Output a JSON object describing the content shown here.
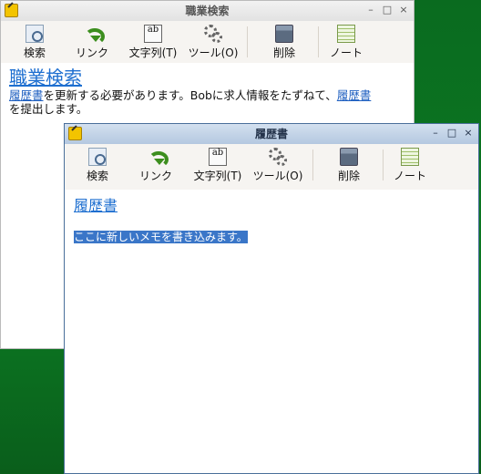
{
  "colors": {
    "link": "#1e5fc0",
    "desktop": "#0c7a23",
    "selection": "#3a76c8"
  },
  "toolbar": {
    "search": "検索",
    "link": "リンク",
    "text": "文字列(T)",
    "tools": "ツール(O)",
    "delete": "削除",
    "note": "ノート",
    "text_icon_glyph": "ab",
    "icons": [
      "magnifier-icon",
      "link-arrow-icon",
      "text-style-icon",
      "gears-icon",
      "trash-icon",
      "note-icon"
    ]
  },
  "back_window": {
    "title": "職業検索",
    "heading": "職業検索",
    "body_link1": "履歴書",
    "body_text1": "を更新する必要があります。Bobに求人情報をたずねて、",
    "body_link2": "履歴書",
    "body_text2": "を提出します。",
    "controls": {
      "minimize": "–",
      "maximize": "□",
      "close": "×"
    }
  },
  "front_window": {
    "title": "履歴書",
    "heading": "履歴書",
    "selected_text": "ここに新しいメモを書き込みます。",
    "controls": {
      "minimize": "–",
      "maximize": "□",
      "close": "×"
    }
  }
}
